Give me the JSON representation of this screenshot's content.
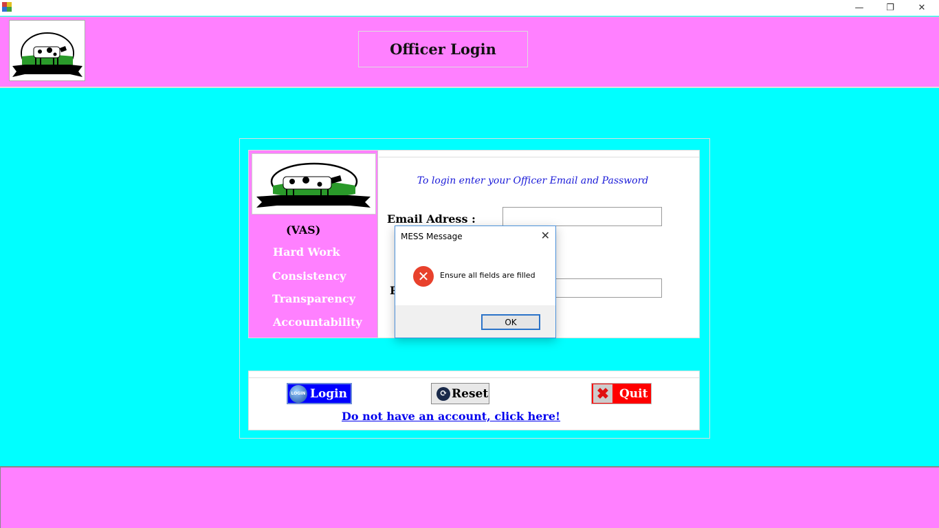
{
  "window": {
    "minimize_glyph": "—",
    "restore_glyph": "❐",
    "close_glyph": "✕"
  },
  "header": {
    "title": "Officer Login"
  },
  "side": {
    "tagline": "(VAS)",
    "values": [
      "Hard Work",
      "Consistency",
      "Transparency",
      "Accountability"
    ]
  },
  "form": {
    "hint": "To login enter your Officer Email and Password",
    "email_label": "Email Adress :",
    "email_value": "",
    "password_label_visible": "P",
    "password_value": ""
  },
  "buttons": {
    "login": "Login",
    "login_badge": "LOGIN",
    "reset": "Reset",
    "quit": "Quit"
  },
  "signup_link": "Do not have an account, click here!",
  "dialog": {
    "title": "MESS Message",
    "message": "Ensure all fields are filled",
    "ok": "OK",
    "close_glyph": "✕",
    "error_glyph": "✕"
  },
  "colors": {
    "header_bg": "#FF80FF",
    "body_bg": "#00FFFF",
    "login_btn": "#0000FF",
    "quit_btn": "#FF0000",
    "link": "#0000EE",
    "hint": "#1a1ad8"
  }
}
